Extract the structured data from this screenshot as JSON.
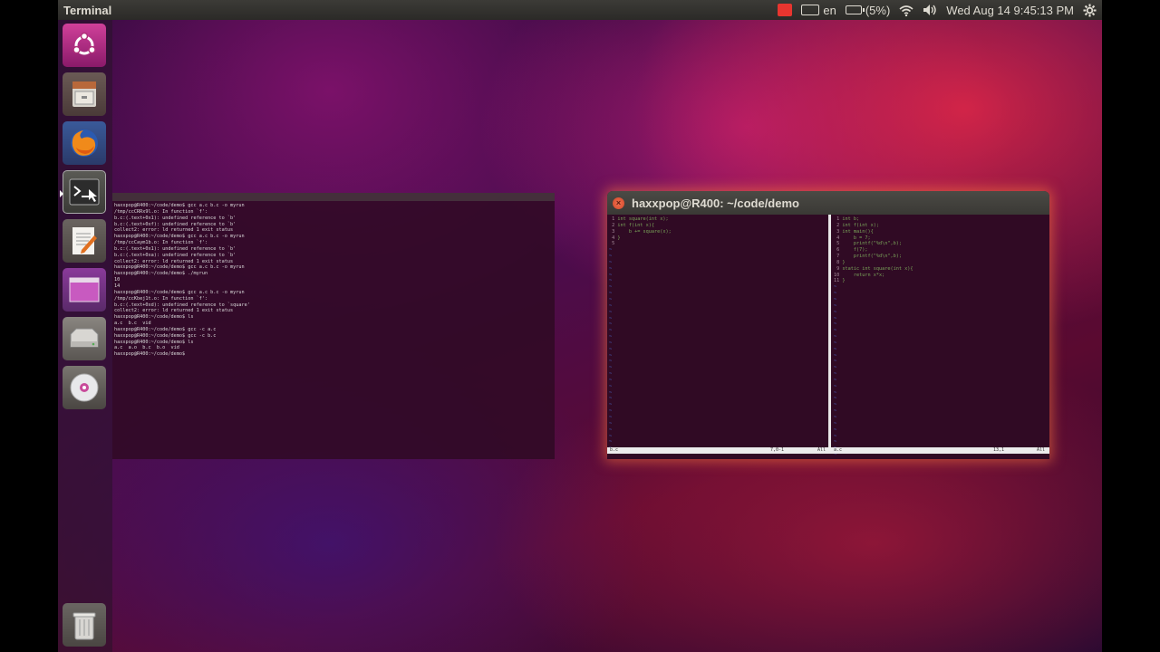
{
  "top_panel": {
    "app_title": "Terminal",
    "keyboard_layout": "en",
    "battery": "(5%)",
    "datetime": "Wed Aug 14  9:45:13 PM",
    "icons": [
      "record-indicator-icon",
      "keyboard-icon",
      "battery-icon",
      "wifi-icon",
      "volume-icon",
      "gear-icon"
    ]
  },
  "launcher": {
    "items": [
      {
        "name": "ubuntu-dash",
        "icon": "ubuntu-logo-icon"
      },
      {
        "name": "files",
        "icon": "file-cabinet-icon"
      },
      {
        "name": "firefox",
        "icon": "firefox-icon"
      },
      {
        "name": "terminal",
        "icon": "terminal-icon",
        "active": true
      },
      {
        "name": "text-editor",
        "icon": "text-editor-icon"
      },
      {
        "name": "workspace-switcher",
        "icon": "workspace-icon"
      },
      {
        "name": "drive",
        "icon": "drive-icon"
      },
      {
        "name": "dvd",
        "icon": "dvd-icon"
      },
      {
        "name": "trash",
        "icon": "trash-icon"
      }
    ]
  },
  "terminal_bg": {
    "lines": [
      "haxxpop@R400:~/code/demo$ gcc a.c b.c -o myrun",
      "/tmp/ccCRRx9l.o: In function `f':",
      "b.c:(.text+0x1): undefined reference to `b'",
      "b.c:(.text+0xf): undefined reference to `b'",
      "collect2: error: ld returned 1 exit status",
      "haxxpop@R400:~/code/demo$ gcc a.c b.c -o myrun",
      "/tmp/ccCaym1b.o: In function `f':",
      "b.c:(.text+0x1): undefined reference to `b'",
      "b.c:(.text+0xa): undefined reference to `b'",
      "collect2: error: ld returned 1 exit status",
      "haxxpop@R400:~/code/demo$ gcc a.c b.c -o myrun",
      "haxxpop@R400:~/code/demo$ ./myrun",
      "10",
      "14",
      "haxxpop@R400:~/code/demo$ gcc a.c b.c -o myrun",
      "/tmp/ccKbej1t.o: In function `f':",
      "b.c:(.text+0xd): undefined reference to `square'",
      "collect2: error: ld returned 1 exit status",
      "haxxpop@R400:~/code/demo$ ls",
      "a.c  b.c  vid",
      "haxxpop@R400:~/code/demo$ gcc -c a.c",
      "haxxpop@R400:~/code/demo$ gcc -c b.c",
      "haxxpop@R400:~/code/demo$ ls",
      "a.c  a.o  b.c  b.o  vid",
      "haxxpop@R400:~/code/demo$ "
    ]
  },
  "terminal_fg": {
    "title": "haxxpop@R400: ~/code/demo",
    "left_pane": [
      {
        "n": "1",
        "code": "int square(int x);"
      },
      {
        "n": "2",
        "code": "int f(int x){"
      },
      {
        "n": "3",
        "code": "    b += square(x);"
      },
      {
        "n": "4",
        "code": "}"
      },
      {
        "n": "5",
        "code": ""
      }
    ],
    "right_pane": [
      {
        "n": "1",
        "code": "int b;"
      },
      {
        "n": "2",
        "code": "int f(int x);"
      },
      {
        "n": "3",
        "code": "int main(){"
      },
      {
        "n": "4",
        "code": "    b = 7;"
      },
      {
        "n": "5",
        "code": "    printf(\"%d\\n\",b);"
      },
      {
        "n": "6",
        "code": "    f(7);"
      },
      {
        "n": "7",
        "code": "    printf(\"%d\\n\",b);"
      },
      {
        "n": "8",
        "code": "}"
      },
      {
        "n": "9",
        "code": "static int square(int x){"
      },
      {
        "n": "10",
        "code": "    return x*x;"
      },
      {
        "n": "11",
        "code": "}"
      }
    ],
    "status_left": {
      "file": "b.c",
      "pos": "7,0-1",
      "scroll": "All"
    },
    "status_right": {
      "file": "a.c",
      "pos": "13,1",
      "scroll": "All"
    }
  }
}
